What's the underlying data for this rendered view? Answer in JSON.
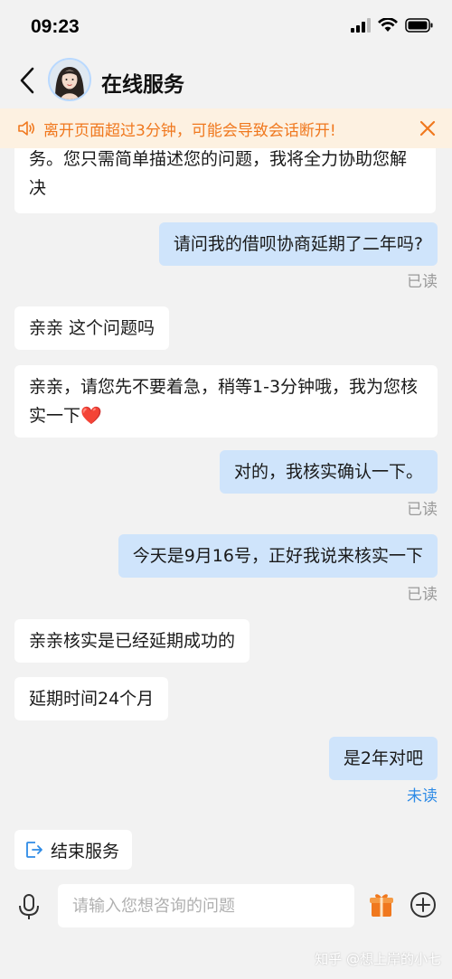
{
  "status_bar": {
    "time": "09:23"
  },
  "header": {
    "title": "在线服务"
  },
  "notice": {
    "text": "离开页面超过3分钟，可能会导致会话断开!"
  },
  "messages": [
    {
      "from": "agent",
      "text": "务。您只需简单描述您的问题，我将全力协助您解决"
    },
    {
      "from": "user",
      "text": "请问我的借呗协商延期了二年吗?",
      "status": "已读"
    },
    {
      "from": "agent",
      "text": "亲亲 这个问题吗"
    },
    {
      "from": "agent",
      "text": "亲亲，请您先不要着急，稍等1-3分钟哦，我为您核实一下❤️"
    },
    {
      "from": "user",
      "text": "对的，我核实确认一下。",
      "status": "已读"
    },
    {
      "from": "user",
      "text": "今天是9月16号，正好我说来核实一下",
      "status": "已读"
    },
    {
      "from": "agent",
      "text": "亲亲核实是已经延期成功的"
    },
    {
      "from": "agent",
      "text": "延期时间24个月"
    },
    {
      "from": "user",
      "text": "是2年对吧",
      "status": "未读"
    }
  ],
  "end_service": {
    "label": "结束服务"
  },
  "input": {
    "placeholder": "请输入您想咨询的问题"
  },
  "watermark": "知乎 @想上岸的小七",
  "colors": {
    "notice_text": "#f0781e",
    "user_bubble": "#cfe4fb",
    "unread": "#2e8be6"
  }
}
